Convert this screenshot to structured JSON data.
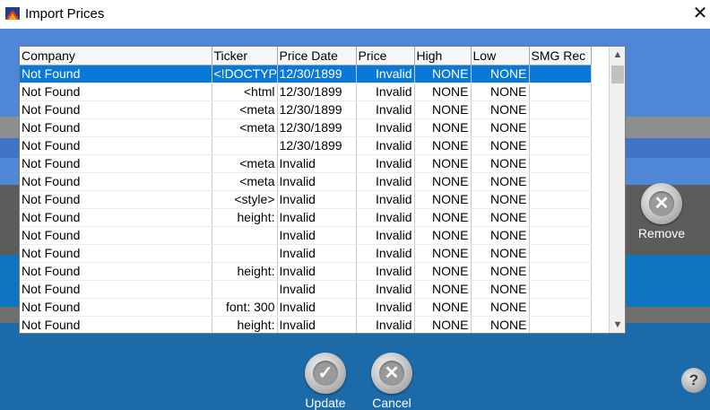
{
  "window": {
    "title": "Import Prices",
    "close_glyph": "✕"
  },
  "grid": {
    "columns": [
      "Company",
      "Ticker",
      "Price Date",
      "Price",
      "High",
      "Low",
      "SMG Rec"
    ],
    "rows": [
      [
        "Not Found",
        "<!DOCTYPE",
        "12/30/1899",
        "Invalid",
        "NONE",
        "NONE",
        ""
      ],
      [
        "Not Found",
        "<html",
        "12/30/1899",
        "Invalid",
        "NONE",
        "NONE",
        ""
      ],
      [
        "Not Found",
        "<meta",
        "12/30/1899",
        "Invalid",
        "NONE",
        "NONE",
        ""
      ],
      [
        "Not Found",
        "<meta",
        "12/30/1899",
        "Invalid",
        "NONE",
        "NONE",
        ""
      ],
      [
        "Not Found",
        "",
        "12/30/1899",
        "Invalid",
        "NONE",
        "NONE",
        ""
      ],
      [
        "Not Found",
        "<meta",
        "Invalid",
        "Invalid",
        "NONE",
        "NONE",
        ""
      ],
      [
        "Not Found",
        "<meta",
        "Invalid",
        "Invalid",
        "NONE",
        "NONE",
        ""
      ],
      [
        "Not Found",
        "<style>",
        "Invalid",
        "Invalid",
        "NONE",
        "NONE",
        ""
      ],
      [
        "Not Found",
        "height:",
        "Invalid",
        "Invalid",
        "NONE",
        "NONE",
        ""
      ],
      [
        "Not Found",
        "",
        "Invalid",
        "Invalid",
        "NONE",
        "NONE",
        ""
      ],
      [
        "Not Found",
        "",
        "Invalid",
        "Invalid",
        "NONE",
        "NONE",
        ""
      ],
      [
        "Not Found",
        "height:",
        "Invalid",
        "Invalid",
        "NONE",
        "NONE",
        ""
      ],
      [
        "Not Found",
        "",
        "Invalid",
        "Invalid",
        "NONE",
        "NONE",
        ""
      ],
      [
        "Not Found",
        "font: 300",
        "Invalid",
        "Invalid",
        "NONE",
        "NONE",
        ""
      ],
      [
        "Not Found",
        "height:",
        "Invalid",
        "Invalid",
        "NONE",
        "NONE",
        ""
      ]
    ],
    "selected_row": 0
  },
  "buttons": {
    "remove": {
      "label": "Remove",
      "icon": "x-icon"
    },
    "update": {
      "label": "Update",
      "icon": "check-icon"
    },
    "cancel": {
      "label": "Cancel",
      "icon": "x-icon"
    },
    "help": {
      "label": "?",
      "icon": "help-icon"
    }
  },
  "scrollbar": {
    "up_glyph": "▲",
    "down_glyph": "▼"
  },
  "colors": {
    "background_blue": "#1c6aa8",
    "band_light_blue": "#4f86d6",
    "band_gray": "#8e8e8e",
    "band_dark_gray": "#5c5c5c",
    "band_mid_blue": "#0f75be",
    "selection": "#0a78d7"
  }
}
